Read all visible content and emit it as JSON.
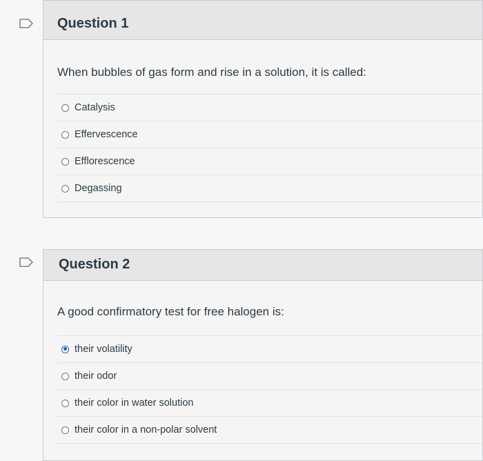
{
  "questions": [
    {
      "title": "Question 1",
      "prompt": "When bubbles of gas form and rise in a solution, it is called:",
      "answers": [
        {
          "label": "Catalysis",
          "selected": false
        },
        {
          "label": "Effervescence",
          "selected": false
        },
        {
          "label": "Efflorescence",
          "selected": false
        },
        {
          "label": "Degassing",
          "selected": false
        }
      ]
    },
    {
      "title": "Question 2",
      "prompt": "A good confirmatory test for free halogen is:",
      "answers": [
        {
          "label": "their volatility",
          "selected": true
        },
        {
          "label": "their odor",
          "selected": false
        },
        {
          "label": "their color in water solution",
          "selected": false
        },
        {
          "label": "their color in a non-polar solvent",
          "selected": false
        }
      ]
    }
  ],
  "colors": {
    "accent": "#1a5fd1",
    "header_bg": "#e6e6e6",
    "border": "#c7cdd1"
  }
}
